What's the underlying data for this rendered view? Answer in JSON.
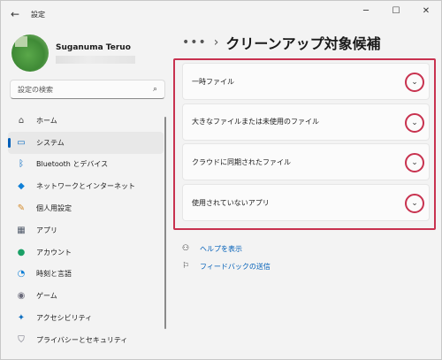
{
  "window": {
    "title": "設定",
    "back_glyph": "←",
    "minimize_glyph": "─",
    "maximize_glyph": "☐",
    "close_glyph": "✕"
  },
  "user": {
    "name": "Suganuma Teruo"
  },
  "search": {
    "placeholder": "設定の検索",
    "icon": "⌕"
  },
  "sidebar": {
    "items": [
      {
        "label": "ホーム",
        "icon": "⌂",
        "icon_name": "home-icon",
        "color": "#505050"
      },
      {
        "label": "システム",
        "icon": "▭",
        "icon_name": "monitor-icon",
        "color": "#0067c0",
        "active": true
      },
      {
        "label": "Bluetooth とデバイス",
        "icon": "ᛒ",
        "icon_name": "bluetooth-icon",
        "color": "#0067c0"
      },
      {
        "label": "ネットワークとインターネット",
        "icon": "◆",
        "icon_name": "wifi-icon",
        "color": "#0f7fd6"
      },
      {
        "label": "個人用設定",
        "icon": "✎",
        "icon_name": "brush-icon",
        "color": "#d48a2a"
      },
      {
        "label": "アプリ",
        "icon": "▦",
        "icon_name": "apps-icon",
        "color": "#505a6a"
      },
      {
        "label": "アカウント",
        "icon": "●",
        "icon_name": "account-icon",
        "color": "#1aa066"
      },
      {
        "label": "時刻と言語",
        "icon": "◔",
        "icon_name": "time-language-icon",
        "color": "#0f7fd6"
      },
      {
        "label": "ゲーム",
        "icon": "◉",
        "icon_name": "gaming-icon",
        "color": "#6a6a7a"
      },
      {
        "label": "アクセシビリティ",
        "icon": "✦",
        "icon_name": "accessibility-icon",
        "color": "#0f6fc0"
      },
      {
        "label": "プライバシーとセキュリティ",
        "icon": "⛉",
        "icon_name": "shield-icon",
        "color": "#6b6b7b"
      }
    ]
  },
  "breadcrumb": {
    "more": "•••",
    "separator": "›",
    "title": "クリーンアップ対象候補"
  },
  "cards": [
    {
      "label": "一時ファイル"
    },
    {
      "label": "大きなファイルまたは未使用のファイル"
    },
    {
      "label": "クラウドに同期されたファイル"
    },
    {
      "label": "使用されていないアプリ"
    }
  ],
  "expand_glyph": "⌄",
  "links": {
    "help": {
      "label": "ヘルプを表示",
      "icon": "⚇"
    },
    "feedback": {
      "label": "フィードバックの送信",
      "icon": "⚐"
    }
  },
  "colors": {
    "accent": "#005fb8",
    "highlight": "#c8324f"
  }
}
